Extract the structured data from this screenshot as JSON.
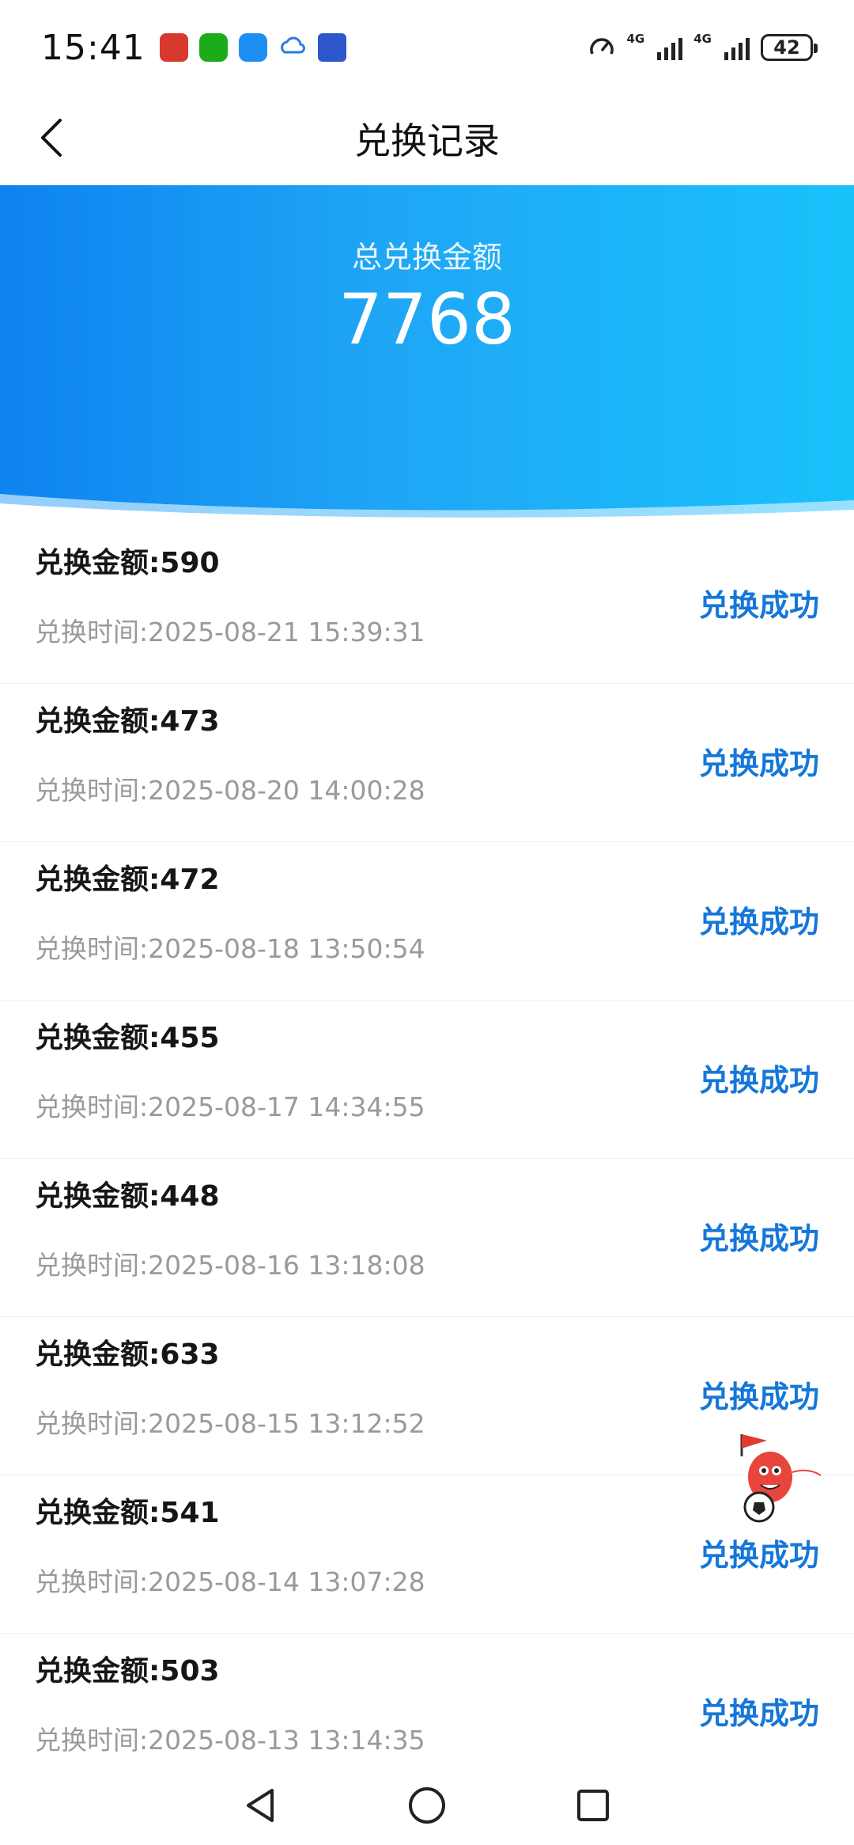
{
  "status_bar": {
    "time": "15:41",
    "battery": "42",
    "network_1": "4G",
    "network_2": "4G",
    "app_icons": [
      "red-app-icon",
      "wechat-icon",
      "message-icon",
      "cloud-app-icon",
      "navy-app-icon"
    ]
  },
  "header": {
    "title": "兑换记录",
    "back_icon": "chevron-left-icon"
  },
  "summary": {
    "label": "总兑换金额",
    "value": "7768"
  },
  "records": [
    {
      "amount": "兑换金额:590",
      "time": "兑换时间:2025-08-21 15:39:31",
      "status": "兑换成功"
    },
    {
      "amount": "兑换金额:473",
      "time": "兑换时间:2025-08-20 14:00:28",
      "status": "兑换成功"
    },
    {
      "amount": "兑换金额:472",
      "time": "兑换时间:2025-08-18 13:50:54",
      "status": "兑换成功"
    },
    {
      "amount": "兑换金额:455",
      "time": "兑换时间:2025-08-17 14:34:55",
      "status": "兑换成功"
    },
    {
      "amount": "兑换金额:448",
      "time": "兑换时间:2025-08-16 13:18:08",
      "status": "兑换成功"
    },
    {
      "amount": "兑换金额:633",
      "time": "兑换时间:2025-08-15 13:12:52",
      "status": "兑换成功"
    },
    {
      "amount": "兑换金额:541",
      "time": "兑换时间:2025-08-14 13:07:28",
      "status": "兑换成功"
    },
    {
      "amount": "兑换金额:503",
      "time": "兑换时间:2025-08-13 13:14:35",
      "status": "兑换成功"
    }
  ],
  "colors": {
    "accent": "#1677d8",
    "header_gradient_start": "#0e83f0",
    "header_gradient_end": "#19c2fb",
    "secondary_text": "#9a9a9a"
  },
  "system_nav": {
    "back": "triangle-back-icon",
    "home": "circle-home-icon",
    "recents": "square-recents-icon"
  }
}
